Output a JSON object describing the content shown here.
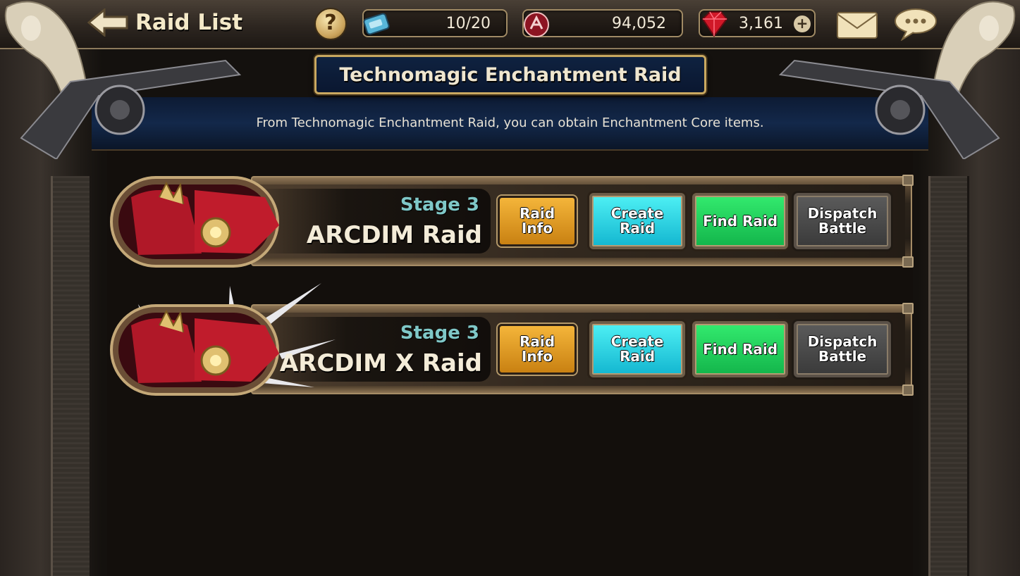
{
  "header": {
    "title": "Raid List",
    "help_label": "?",
    "stamina": "10/20",
    "points": "94,052",
    "gems": "3,161",
    "plus_label": "+"
  },
  "banner": {
    "title": "Technomagic Enchantment Raid",
    "description": "From Technomagic Enchantment Raid, you can obtain Enchantment Core items."
  },
  "raids": [
    {
      "stage": "Stage 3",
      "name": "ARCDIM Raid",
      "info_label": "Raid\nInfo",
      "create_label": "Create\nRaid",
      "find_label": "Find Raid",
      "dispatch_label": "Dispatch\nBattle"
    },
    {
      "stage": "Stage 3",
      "name": "ARCDIM X Raid",
      "info_label": "Raid\nInfo",
      "create_label": "Create\nRaid",
      "find_label": "Find Raid",
      "dispatch_label": "Dispatch\nBattle"
    }
  ],
  "colors": {
    "raid_info": "#e8a020",
    "create_raid": "#2ad6ea",
    "find_raid": "#22d05c",
    "dispatch_battle": "#4a4a4a",
    "stage_text": "#7fc8c8"
  }
}
